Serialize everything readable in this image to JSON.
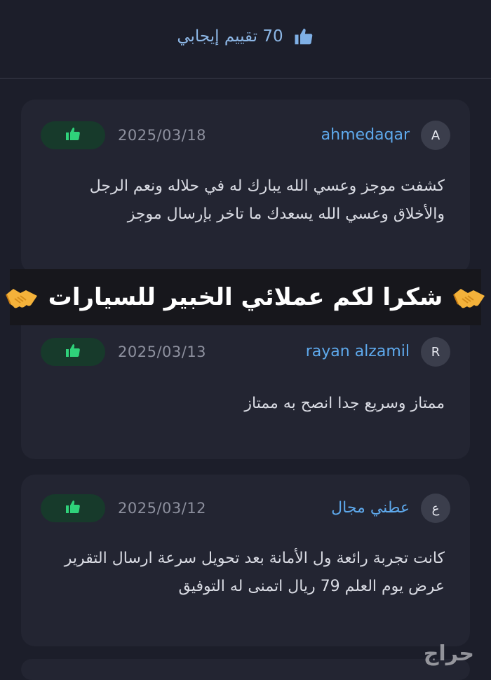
{
  "header": {
    "rating_text": "70 تقييم إيجابي",
    "icon": "thumbs-up-icon"
  },
  "reviews": [
    {
      "avatar_letter": "A",
      "username": "ahmedaqar",
      "date": "2025/03/18",
      "badge_icon": "thumbs-up-icon",
      "text": "كشفت موجز وعسي الله يبارك له في حلاله ونعم الرجل والأخلاق وعسي الله يسعدك ما تاخر بإرسال موجز"
    },
    {
      "avatar_letter": "R",
      "username": "rayan alzamil",
      "date": "2025/03/13",
      "badge_icon": "thumbs-up-icon",
      "text": "ممتاز وسريع جدا انصح به ممتاز"
    },
    {
      "avatar_letter": "ع",
      "username": "عطني مجال",
      "date": "2025/03/12",
      "badge_icon": "thumbs-up-icon",
      "text": "كانت تجربة رائعة ول الأمانة بعد تحويل سرعة ارسال التقرير عرض يوم العلم 79 ريال اتمنى له التوفيق"
    }
  ],
  "overlay": {
    "text": "شكرا لكم عملائي الخبير للسيارات",
    "icon": "handshake-icon"
  },
  "watermark": "حراج",
  "colors": {
    "background": "#1c1e2a",
    "card": "#232532",
    "username": "#5ea9ec",
    "header_text": "#8db7e6",
    "badge_bg": "#173a2b",
    "thumb_green": "#2fd27a",
    "thumb_blue": "#7fb0e6"
  }
}
